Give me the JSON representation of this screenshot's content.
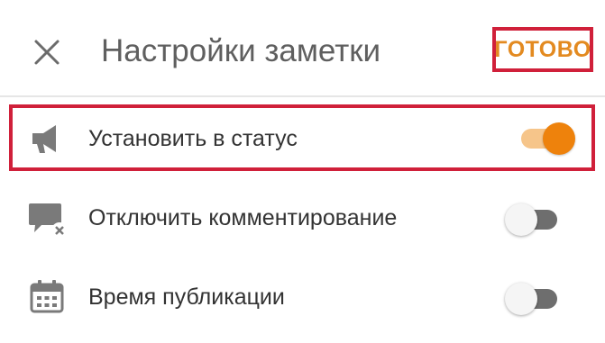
{
  "header": {
    "title": "Настройки заметки",
    "done_label": "ГОТОВО",
    "close_icon": "close-icon"
  },
  "settings": [
    {
      "icon": "megaphone-icon",
      "label": "Установить в статус",
      "enabled": true
    },
    {
      "icon": "comment-off-icon",
      "label": "Отключить комментирование",
      "enabled": false
    },
    {
      "icon": "calendar-icon",
      "label": "Время публикации",
      "enabled": false
    }
  ],
  "colors": {
    "accent": "#ee820c",
    "accent_light": "#f6c58a",
    "highlight_border": "#d0203a",
    "icon_gray": "#7a7a7a"
  }
}
